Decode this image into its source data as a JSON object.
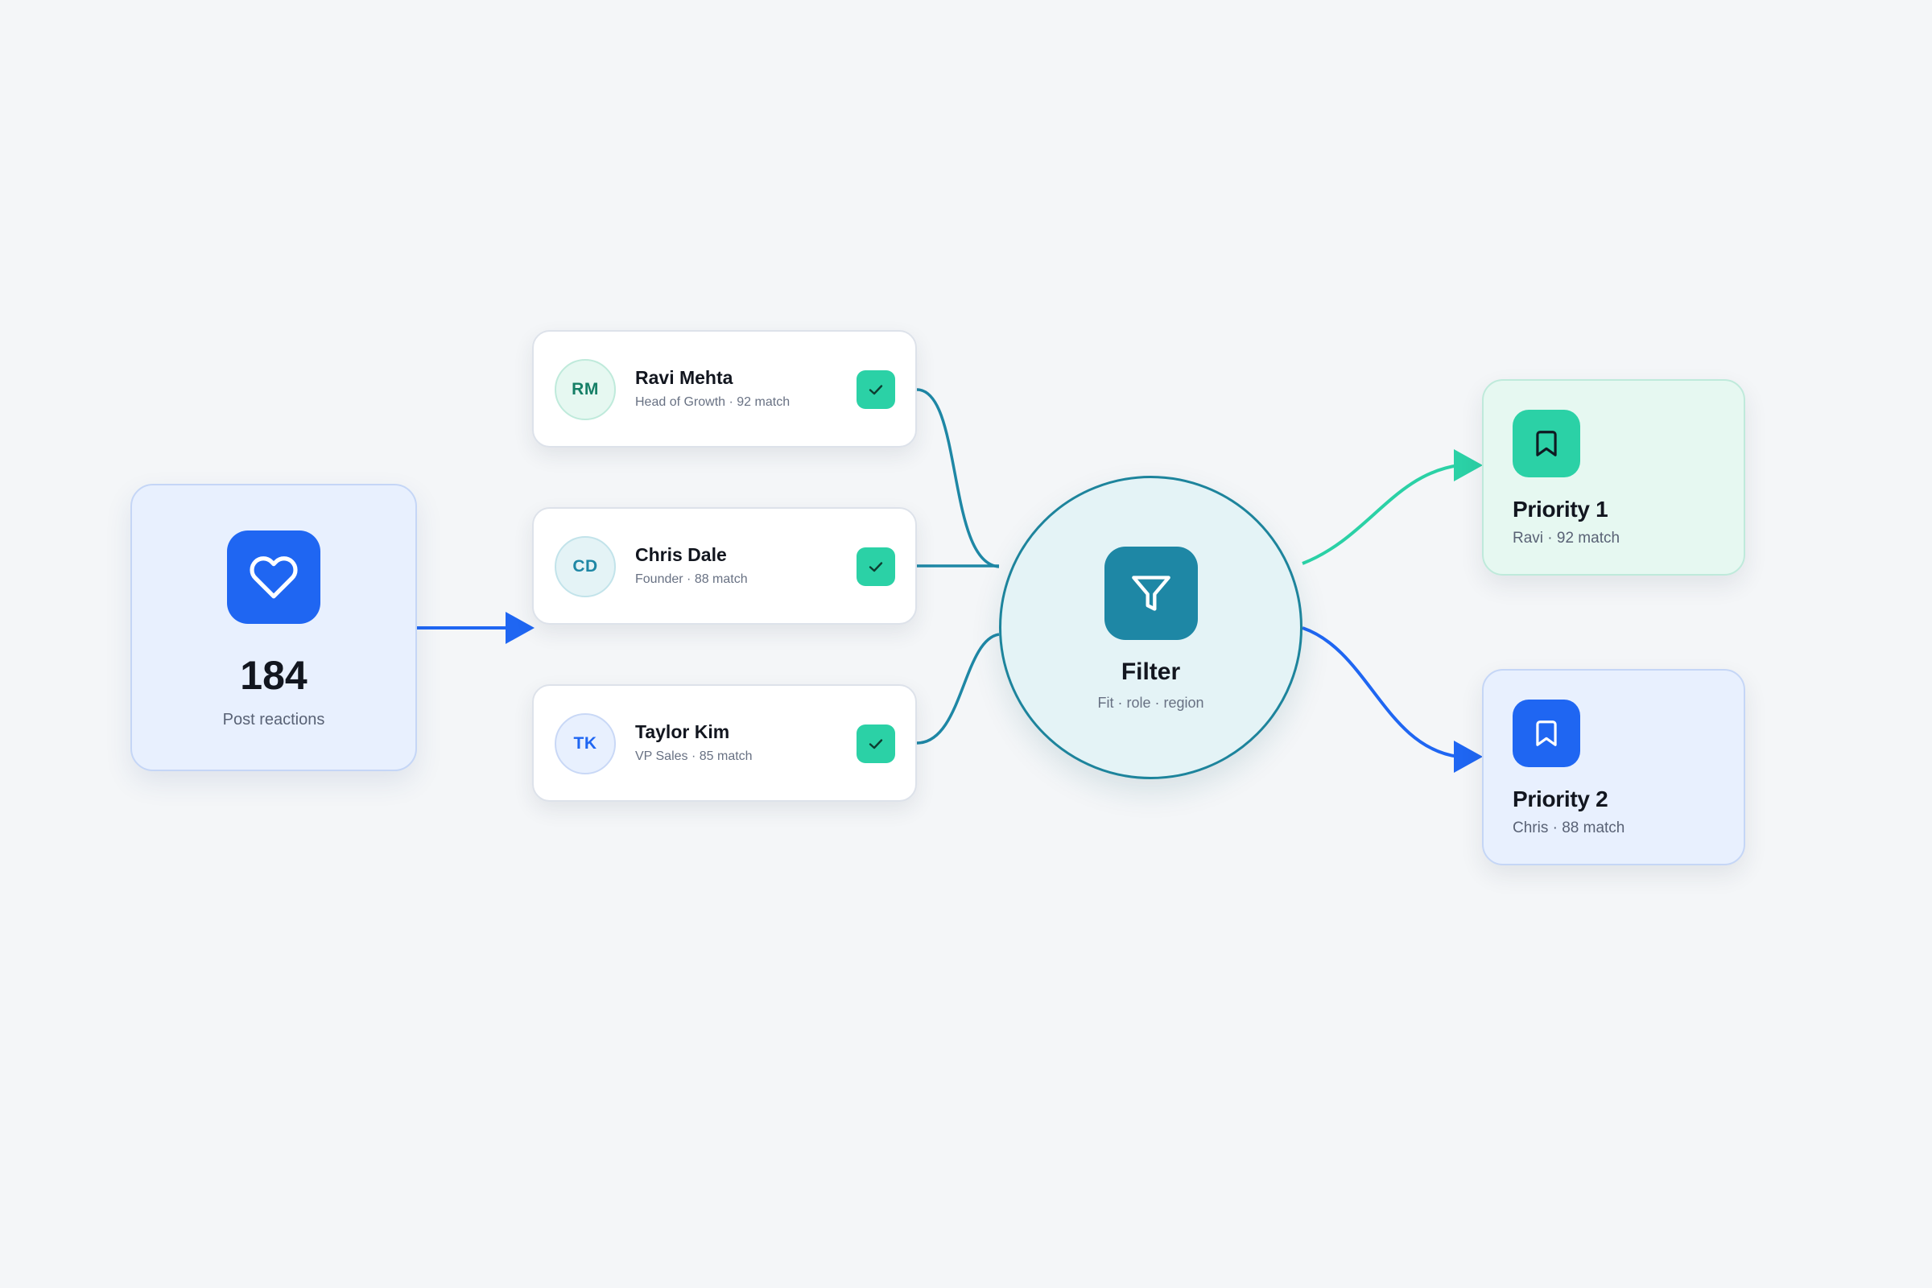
{
  "source": {
    "count": "184",
    "label": "Post reactions",
    "icon": "heart-icon"
  },
  "leads": [
    {
      "initials": "RM",
      "name": "Ravi Mehta",
      "meta": "Head of Growth · 92 match",
      "checked": true,
      "avatar_color": "#157f66",
      "avatar_bg": "#e6f8f1"
    },
    {
      "initials": "CD",
      "name": "Chris Dale",
      "meta": "Founder · 88 match",
      "checked": true,
      "avatar_color": "#1e87a5",
      "avatar_bg": "#e4f3f6"
    },
    {
      "initials": "TK",
      "name": "Taylor Kim",
      "meta": "VP Sales · 85 match",
      "checked": true,
      "avatar_color": "#1f66f2",
      "avatar_bg": "#e8f0fe"
    }
  ],
  "filter": {
    "title": "Filter",
    "subtitle": "Fit · role · region",
    "icon": "funnel-icon"
  },
  "priorities": [
    {
      "title": "Priority 1",
      "subtitle": "Ravi · 92 match",
      "icon": "bookmark-icon",
      "color": "#2bd1a6"
    },
    {
      "title": "Priority 2",
      "subtitle": "Chris · 88 match",
      "icon": "bookmark-icon",
      "color": "#1f66f2"
    }
  ],
  "colors": {
    "background": "#f4f6f8",
    "blue": "#1f66f2",
    "teal": "#1e87a5",
    "green": "#2bd1a6"
  }
}
